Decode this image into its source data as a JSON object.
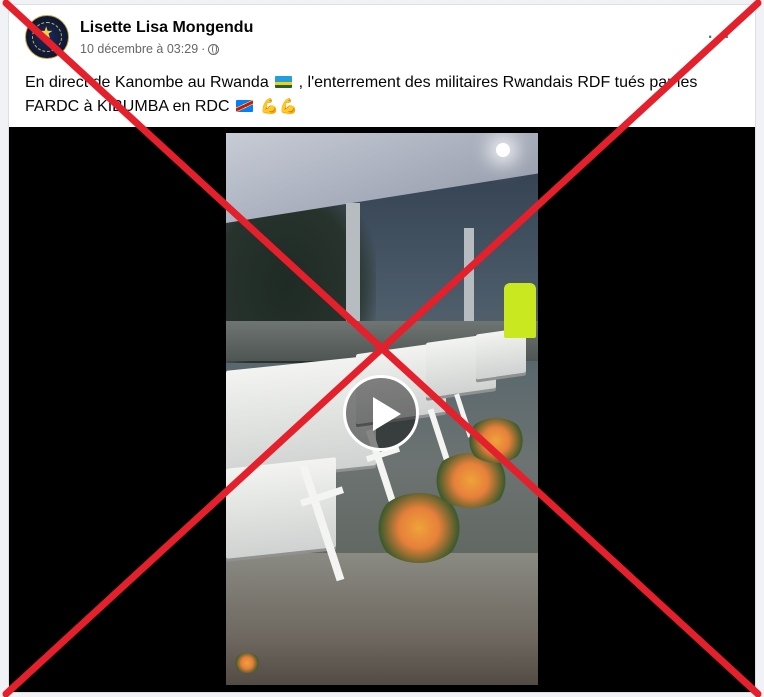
{
  "post": {
    "author_name": "Lisette Lisa Mongendu",
    "timestamp": "10 décembre à 03:29",
    "separator": "·",
    "more_label": "···",
    "text_part1": "En direct de Kanombe au Rwanda",
    "text_part2": ", l'enterrement des militaires Rwandais RDF tués par les FARDC à KIBUMBA en RDC",
    "arm_emojis": "💪💪"
  },
  "icons": {
    "avatar": "avatar-image",
    "privacy": "globe-icon",
    "flag1": "rwanda-flag-icon",
    "flag2": "drc-flag-icon",
    "play": "play-icon",
    "overlay": "red-x-overlay"
  },
  "colors": {
    "x_overlay": "#e3202b",
    "text": "#050505",
    "meta": "#65676b"
  }
}
